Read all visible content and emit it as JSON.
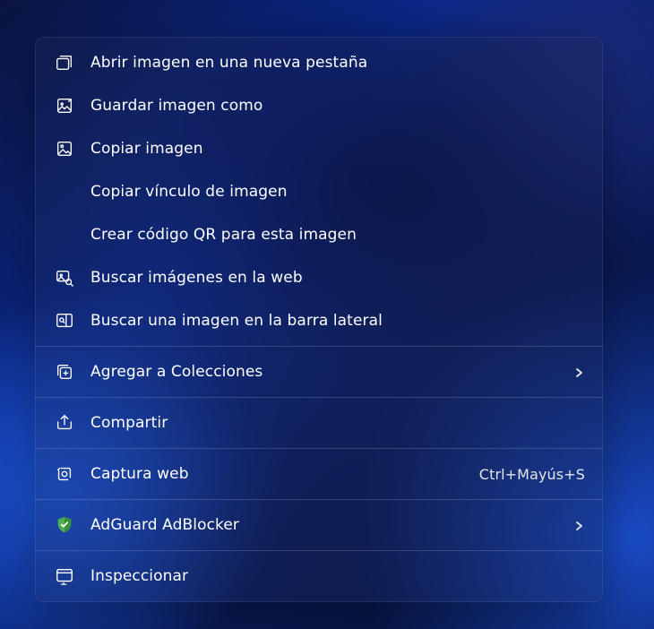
{
  "menu": {
    "groups": [
      [
        {
          "id": "open-image-new-tab",
          "icon": "open-new-tab-icon",
          "label": "Abrir imagen en una nueva pestaña"
        },
        {
          "id": "save-image-as",
          "icon": "save-image-icon",
          "label": "Guardar imagen como"
        },
        {
          "id": "copy-image",
          "icon": "copy-image-icon",
          "label": "Copiar imagen"
        },
        {
          "id": "copy-image-link",
          "icon": null,
          "label": "Copiar vínculo de imagen"
        },
        {
          "id": "create-qr",
          "icon": null,
          "label": "Crear código QR para esta imagen"
        },
        {
          "id": "search-web-images",
          "icon": "image-search-icon",
          "label": "Buscar imágenes en la web"
        },
        {
          "id": "search-image-sidebar",
          "icon": "sidebar-search-icon",
          "label": "Buscar una imagen en la barra lateral"
        }
      ],
      [
        {
          "id": "add-to-collections",
          "icon": "collections-add-icon",
          "label": "Agregar a Colecciones",
          "submenu": true
        }
      ],
      [
        {
          "id": "share",
          "icon": "share-icon",
          "label": "Compartir"
        }
      ],
      [
        {
          "id": "web-capture",
          "icon": "web-capture-icon",
          "label": "Captura web",
          "accel": "Ctrl+Mayús+S"
        }
      ],
      [
        {
          "id": "adguard",
          "icon": "shield-icon",
          "label": "AdGuard AdBlocker",
          "submenu": true
        }
      ],
      [
        {
          "id": "inspect",
          "icon": "inspect-icon",
          "label": "Inspeccionar"
        }
      ]
    ]
  }
}
